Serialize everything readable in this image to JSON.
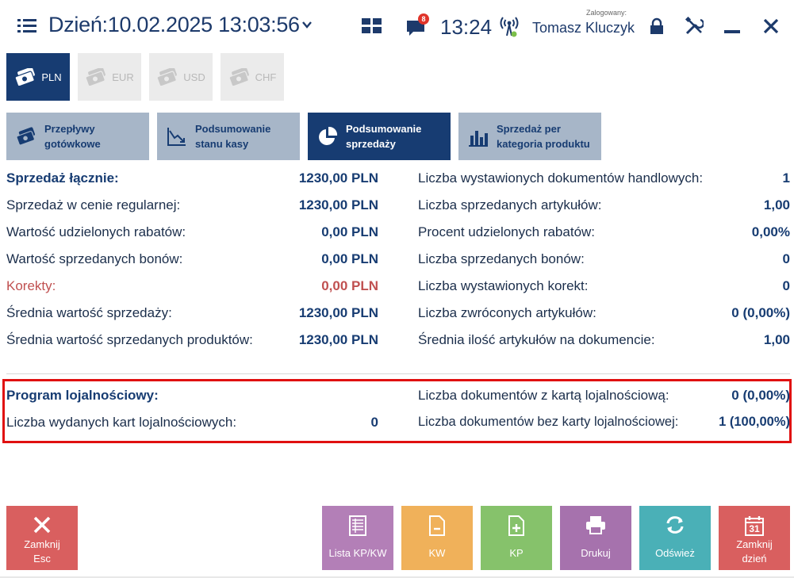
{
  "header": {
    "day_text": "Dzień:10.02.2025 13:03:56",
    "messages_badge": "8",
    "time": "13:24",
    "logged_label": "Zalogowany:",
    "user_name": "Tomasz Kluczyk"
  },
  "currencies": [
    {
      "label": "PLN",
      "active": true
    },
    {
      "label": "EUR",
      "active": false
    },
    {
      "label": "USD",
      "active": false
    },
    {
      "label": "CHF",
      "active": false
    }
  ],
  "tabs": [
    {
      "label": "Przepływy\ngotówkowe",
      "icon": "cash-flow-icon",
      "active": false
    },
    {
      "label": "Podsumowanie\nstanu kasy",
      "icon": "chart-down-icon",
      "active": false
    },
    {
      "label": "Podsumowanie\nsprzedaży",
      "icon": "pie-chart-icon",
      "active": true
    },
    {
      "label": "Sprzedaż per\nkategoria produktu",
      "icon": "bar-chart-icon",
      "active": false
    }
  ],
  "left_summary": [
    {
      "label": "Sprzedaż łącznie:",
      "value": "1230,00 PLN"
    },
    {
      "label": "Sprzedaż w cenie regularnej:",
      "value": "1230,00 PLN"
    },
    {
      "label": "Wartość udzielonych rabatów:",
      "value": "0,00 PLN"
    },
    {
      "label": "Wartość sprzedanych bonów:",
      "value": "0,00 PLN"
    },
    {
      "label": "Korekty:",
      "value": "0,00 PLN"
    },
    {
      "label": "Średnia wartość sprzedaży:",
      "value": "1230,00 PLN"
    },
    {
      "label": "Średnia wartość sprzedanych produktów:",
      "value": "1230,00 PLN"
    }
  ],
  "right_summary": [
    {
      "label": "Liczba wystawionych dokumentów handlowych:",
      "value": "1"
    },
    {
      "label": "Liczba sprzedanych artykułów:",
      "value": "1,00"
    },
    {
      "label": "Procent udzielonych rabatów:",
      "value": "0,00%"
    },
    {
      "label": "Liczba sprzedanych bonów:",
      "value": "0"
    },
    {
      "label": "Liczba wystawionych korekt:",
      "value": "0"
    },
    {
      "label": "Liczba zwróconych artykułów:",
      "value": "0 (0,00%)"
    },
    {
      "label": "Średnia ilość artykułów na dokumencie:",
      "value": "1,00"
    }
  ],
  "loyalty": {
    "title": "Program lojalnościowy:",
    "cards_label": "Liczba wydanych kart lojalnościowych:",
    "cards_value": "0",
    "with_card_label": "Liczba dokumentów z kartą lojalnościową:",
    "with_card_value": "0 (0,00%)",
    "without_card_label": "Liczba dokumentów bez karty lojalnościowej:",
    "without_card_value": "1 (100,00%)"
  },
  "buttons": {
    "close": "Zamknij\nEsc",
    "lista": "Lista KP/KW",
    "kw": "KW",
    "kp": "KP",
    "print": "Drukuj",
    "refresh": "Odśwież",
    "close_day": "Zamknij\ndzień",
    "calendar_day": "31"
  },
  "colors": {
    "navy": "#173c72",
    "tab_inactive": "#a7b6c8",
    "red_highlight": "#e01010",
    "correction_red": "#c05050"
  }
}
